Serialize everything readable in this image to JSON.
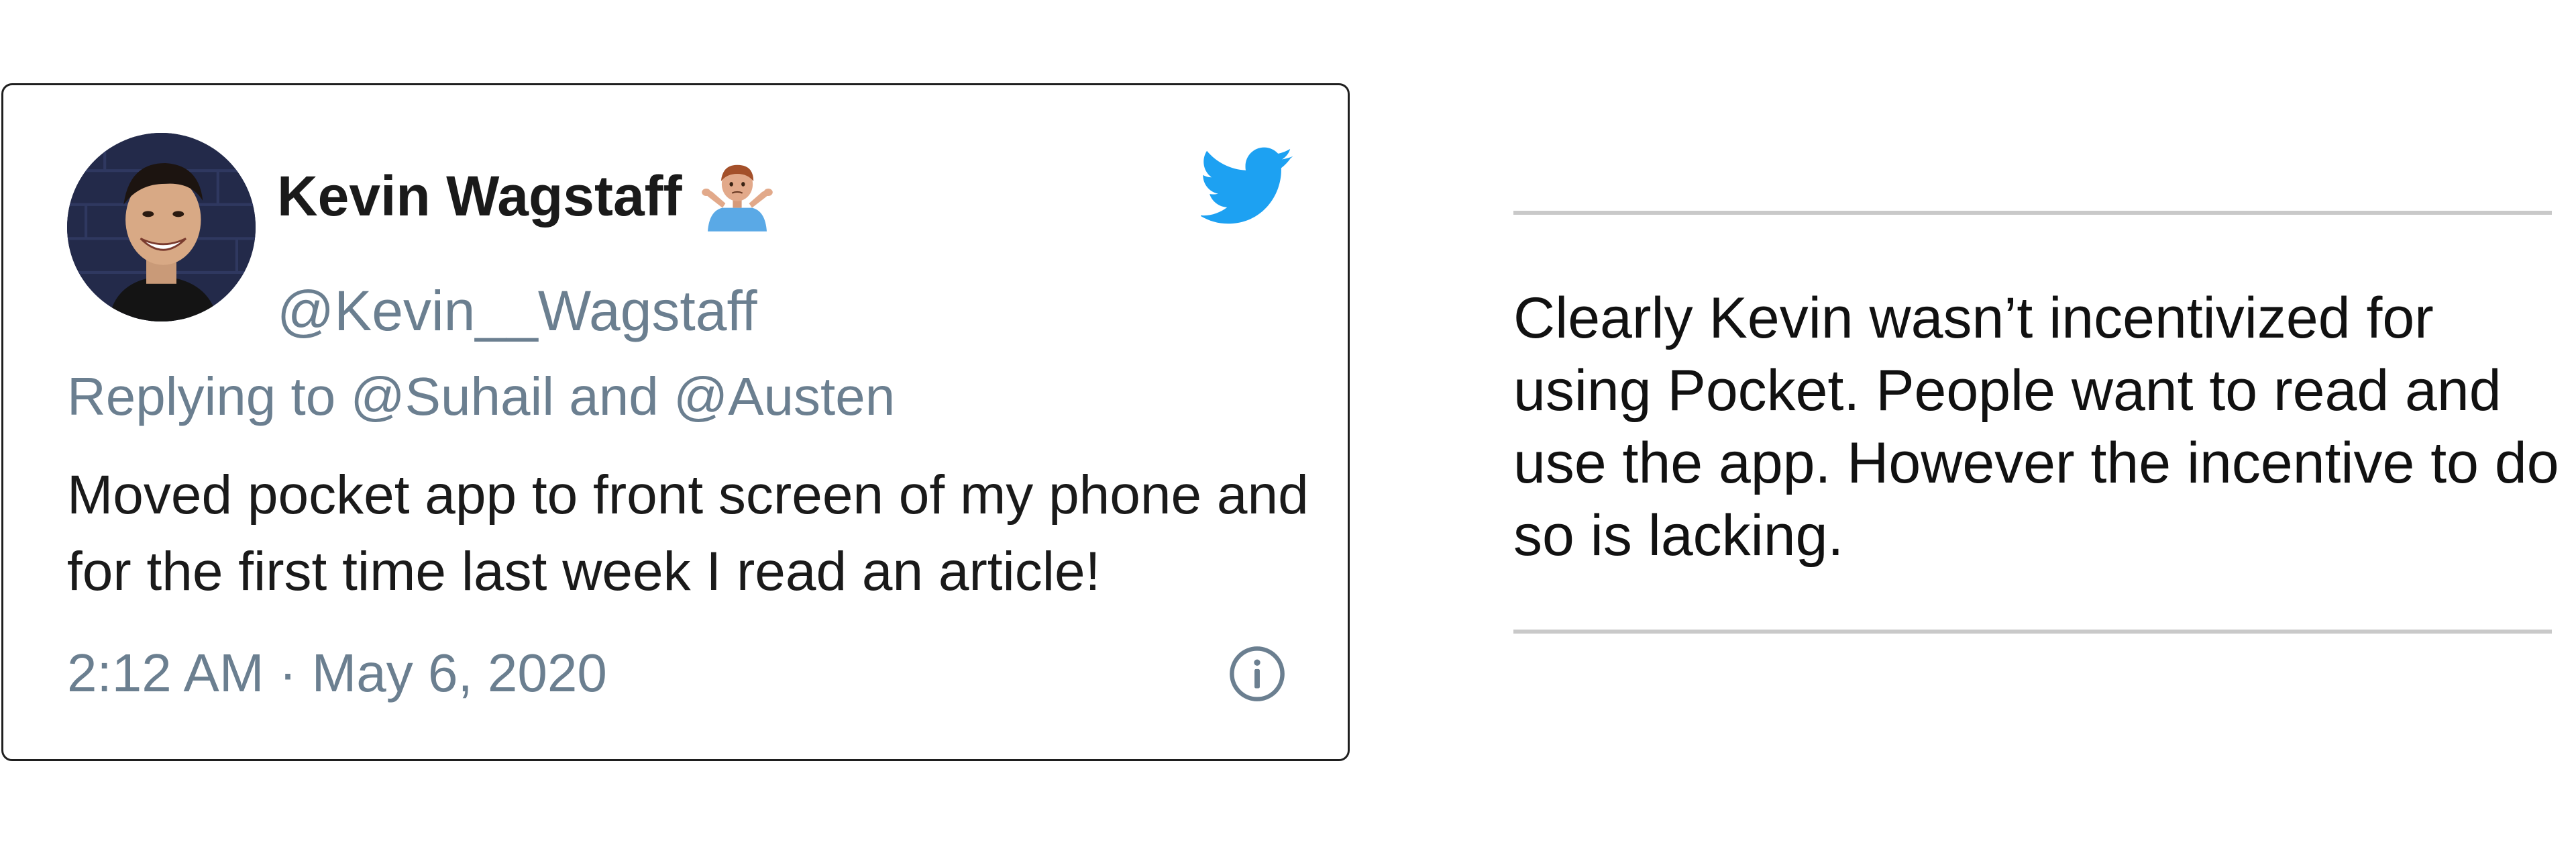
{
  "tweet": {
    "display_name": "Kevin Wagstaff",
    "name_emoji_icon": "person-shrugging-icon",
    "handle": "@Kevin__Wagstaff",
    "reply_line": "Replying to @Suhail and @Austen",
    "text": "Moved pocket app to front screen of my phone and for the first time last week I read an article!",
    "timestamp": "2:12 AM · May 6, 2020",
    "brand_icon": "twitter-bird-icon",
    "info_icon": "info-circle-icon"
  },
  "caption": {
    "text": "Clearly Kevin wasn’t incentivized for using Pocket. People want to read and use the app. However the incentive to do so is lacking."
  },
  "colors": {
    "twitter_blue": "#1da1f2",
    "muted_text": "#6b7f90",
    "primary_text": "#1a1a1a",
    "card_border": "#1f1f1f",
    "divider": "#c9c9c9"
  }
}
